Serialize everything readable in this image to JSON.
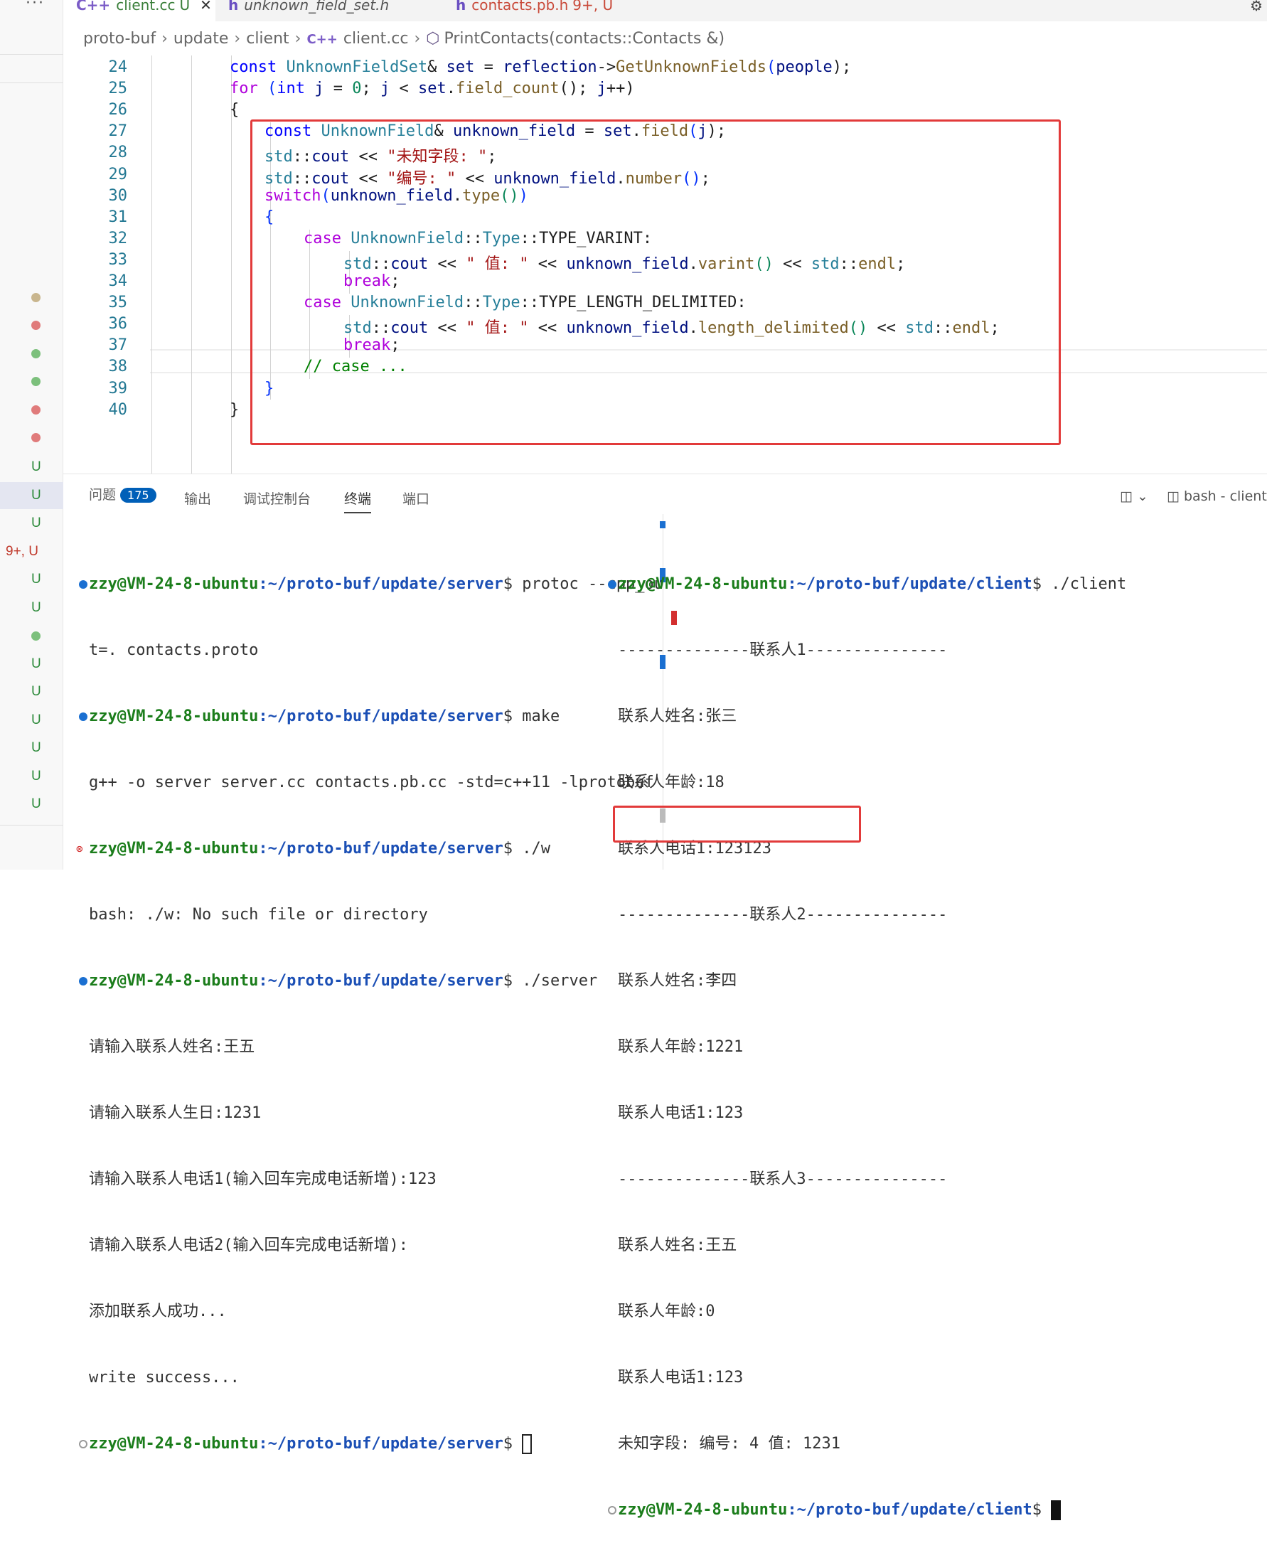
{
  "tabs": [
    {
      "icon": "C++",
      "name": "client.cc",
      "status": "U",
      "close": "✕"
    },
    {
      "icon": "h",
      "name": "unknown_field_set.h",
      "status": ""
    },
    {
      "icon": "h",
      "name": "contacts.pb.h",
      "status": "9+, U"
    }
  ],
  "breadcrumb": [
    "proto-buf",
    "update",
    "client",
    "client.cc",
    "PrintContacts(contacts::Contacts &)"
  ],
  "breadcrumb_cpp_icon": "C++",
  "activity": {
    "more": "···",
    "labels": [
      "U",
      "U",
      "U",
      "9+, U",
      "U",
      "U",
      "U",
      "U",
      "U",
      "U",
      "U",
      "U"
    ]
  },
  "editor": {
    "line_numbers": [
      "24",
      "25",
      "26",
      "27",
      "28",
      "29",
      "30",
      "31",
      "32",
      "33",
      "34",
      "35",
      "36",
      "37",
      "38",
      "39",
      "40"
    ]
  },
  "code_text": {
    "l24": {
      "a": "const ",
      "b": "UnknownFieldSet",
      "c": "& ",
      "d": "set",
      " e": "",
      "f": " = ",
      "g": "reflection",
      "h": "->",
      "i": "GetUnknownFields",
      "j": "(",
      "k": "people",
      "l": ");"
    },
    "l25": {
      "a": "for ",
      "b": "(",
      "c": "int ",
      "d": "j",
      " e": " = ",
      "f": "0",
      "g": "; ",
      "h": "j",
      "i": " < ",
      "j": "set",
      "k": ".",
      "l": "field_count",
      "m": "(); ",
      "n": "j",
      "o": "++)"
    },
    "l26": "{",
    "l27": {
      "a": "const ",
      "b": "UnknownField",
      "c": "& ",
      "d": "unknown_field",
      "e": " = ",
      "f": "set",
      "g": ".",
      "h": "field",
      "i": "(",
      "j": "j",
      "k": ");"
    },
    "l28": {
      "a": "std",
      "b": "::",
      "c": "cout",
      "d": " << ",
      "e": "\"未知字段: \"",
      "f": ";"
    },
    "l29": {
      "a": "std",
      "b": "::",
      "c": "cout",
      "d": " << ",
      "e": "\"编号: \"",
      "f": " << ",
      "g": "unknown_field",
      "h": ".",
      "i": "number",
      "j": "()",
      "k": ";"
    },
    "l30": {
      "a": "switch",
      "b": "(",
      "c": "unknown_field",
      "d": ".",
      "e": "type",
      "f": "()",
      "g": ")"
    },
    "l31": "{",
    "l32": {
      "a": "case ",
      "b": "UnknownField",
      "c": "::",
      "d": "Type",
      "e": "::",
      "f": "TYPE_VARINT",
      "g": ":"
    },
    "l33": {
      "a": "std",
      "b": "::",
      "c": "cout",
      "d": " << ",
      "e": "\" 值: \"",
      "f": " << ",
      "g": "unknown_field",
      "h": ".",
      "i": "varint",
      "j": "()",
      "k": " << ",
      "l": "std",
      "m": "::",
      "n": "endl",
      "o": ";"
    },
    "l34": {
      "a": "break",
      "b": ";"
    },
    "l35": {
      "a": "case ",
      "b": "UnknownField",
      "c": "::",
      "d": "Type",
      "e": "::",
      "f": "TYPE_LENGTH_DELIMITED",
      "g": ":"
    },
    "l36": {
      "a": "std",
      "b": "::",
      "c": "cout",
      "d": " << ",
      "e": "\" 值: \"",
      "f": " << ",
      "g": "unknown_field",
      "h": ".",
      "i": "length_delimited",
      "j": "()",
      "k": " << ",
      "l": "std",
      "m": "::",
      "n": "endl",
      "o": ";"
    },
    "l37": {
      "a": "break",
      "b": ";"
    },
    "l38": "// case ...",
    "l39": "}",
    "l40": "}"
  },
  "panel": {
    "tabs": [
      "问题",
      "输出",
      "调试控制台",
      "终端",
      "端口"
    ],
    "problems_count": "175",
    "active_tab": "终端",
    "terminal_name": "bash - client"
  },
  "terminal_left": {
    "prompt_user": "zzy@VM-24-8-ubuntu",
    "path_server": ":~/proto-buf/update/server",
    "dollar": "$ ",
    "cmd1": "protoc --cpp_ou",
    "cmd1b": "t=. contacts.proto",
    "cmd2": "make",
    "out2": "g++ -o server server.cc contacts.pb.cc -std=c++11 -lprotobuf",
    "cmd3": "./w",
    "out3": "bash: ./w: No such file or directory",
    "cmd4": "./server",
    "out4": [
      "请输入联系人姓名:王五",
      "请输入联系人生日:1231",
      "请输入联系人电话1(输入回车完成电话新增):123",
      "请输入联系人电话2(输入回车完成电话新增):",
      "添加联系人成功...",
      "write success..."
    ],
    "err_mark": "⊗"
  },
  "terminal_right": {
    "prompt_user": "zzy@VM-24-8-ubuntu",
    "path_client": ":~/proto-buf/update/client",
    "dollar": "$ ",
    "cmd": "./client",
    "lines": [
      "--------------联系人1---------------",
      "联系人姓名:张三",
      "联系人年龄:18",
      "联系人电话1:123123",
      "--------------联系人2---------------",
      "联系人姓名:李四",
      "联系人年龄:1221",
      "联系人电话1:123",
      "--------------联系人3---------------",
      "联系人姓名:王五",
      "联系人年龄:0",
      "联系人电话1:123"
    ],
    "unknown_line": "未知字段: 编号: 4 值: 1231"
  },
  "colors": {
    "highlight_box": "#e23a3a",
    "accent": "#005fb8",
    "prompt_green": "#1b7d1b",
    "path_blue": "#1b4fb5"
  }
}
